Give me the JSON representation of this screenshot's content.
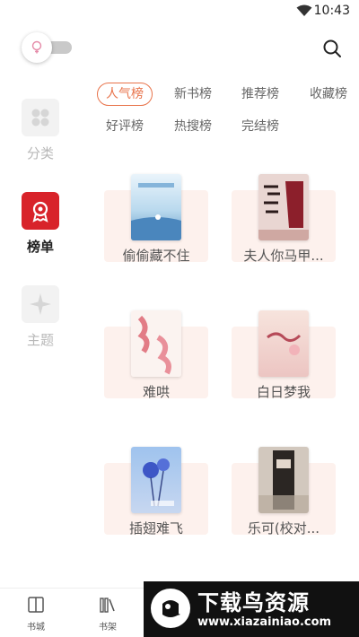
{
  "status_bar": {
    "time": "10:43"
  },
  "side_nav": [
    {
      "label": "分类",
      "active": false
    },
    {
      "label": "榜单",
      "active": true
    },
    {
      "label": "主题",
      "active": false
    }
  ],
  "tabs": [
    "人气榜",
    "新书榜",
    "推荐榜",
    "收藏榜",
    "好评榜",
    "热搜榜",
    "完结榜"
  ],
  "active_tab": "人气榜",
  "books": [
    {
      "title": "偷偷藏不住"
    },
    {
      "title": "夫人你马甲..."
    },
    {
      "title": "难哄"
    },
    {
      "title": "白日梦我"
    },
    {
      "title": "插翅难飞"
    },
    {
      "title": "乐可(校对..."
    }
  ],
  "bottom_nav": [
    {
      "label": "书城"
    },
    {
      "label": "书架"
    }
  ],
  "watermark": {
    "title": "下载鸟资源",
    "url": "www.xiazainiao.com"
  },
  "colors": {
    "accent": "#e8734a",
    "rank_icon": "#d8232a",
    "card_bg": "#fdf1ed"
  }
}
